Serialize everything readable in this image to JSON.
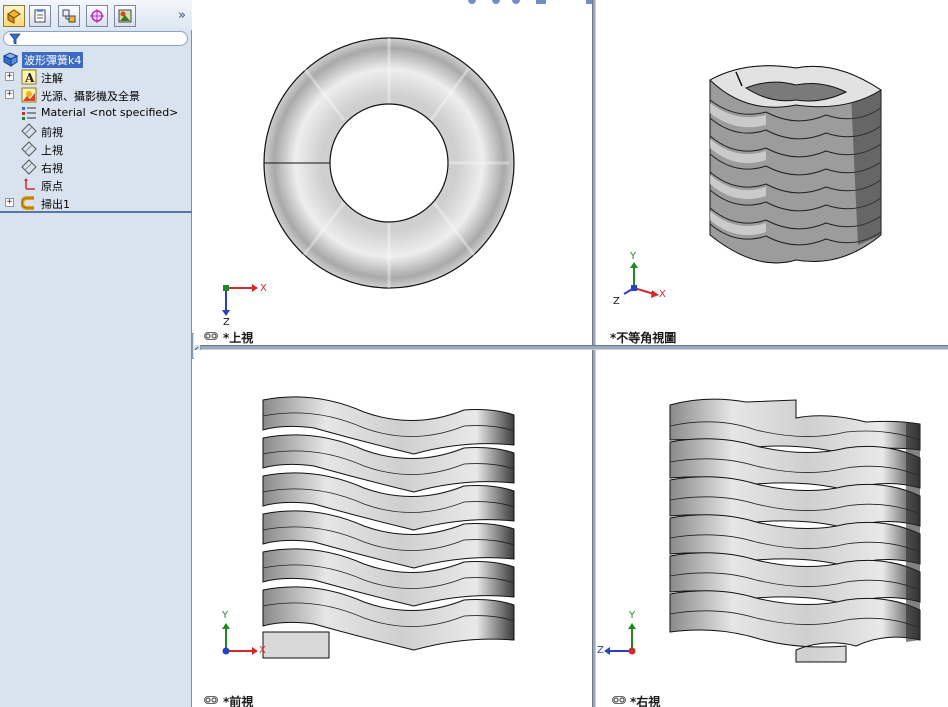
{
  "panel": {
    "collapse_glyph": "»",
    "tabs": [
      "feature-manager-icon",
      "property-manager-icon",
      "configuration-manager-icon",
      "dimxpert-icon",
      "display-manager-icon"
    ],
    "filter_icon": "filter-icon"
  },
  "tree": {
    "root": "波形彈簧k4",
    "items": [
      {
        "label": "注解",
        "icon": "annotations-icon",
        "expandable": true
      },
      {
        "label": "光源、攝影機及全景",
        "icon": "lights-camera-icon",
        "expandable": true
      },
      {
        "label": "Material <not specified>",
        "icon": "material-icon",
        "expandable": false
      },
      {
        "label": "前視",
        "icon": "plane-icon",
        "expandable": false
      },
      {
        "label": "上視",
        "icon": "plane-icon",
        "expandable": false
      },
      {
        "label": "右視",
        "icon": "plane-icon",
        "expandable": false
      },
      {
        "label": "原点",
        "icon": "origin-icon",
        "expandable": false
      },
      {
        "label": "掃出1",
        "icon": "sweep-icon",
        "expandable": true
      }
    ]
  },
  "viewports": {
    "top": {
      "label": "*上視",
      "axes": [
        "X",
        "Z"
      ]
    },
    "iso": {
      "label": "*不等角視圖",
      "axes": [
        "Y",
        "Z",
        "X"
      ]
    },
    "front": {
      "label": "*前視",
      "axes": [
        "Y",
        "X"
      ]
    },
    "right": {
      "label": "*右視",
      "axes": [
        "Y",
        "Z"
      ]
    }
  },
  "colors": {
    "x_axis": "#d12a2a",
    "y_axis": "#1e8a1e",
    "z_axis": "#2a3fc4",
    "panel_bg": "#d9e3ef",
    "selection": "#3d6bc4"
  }
}
